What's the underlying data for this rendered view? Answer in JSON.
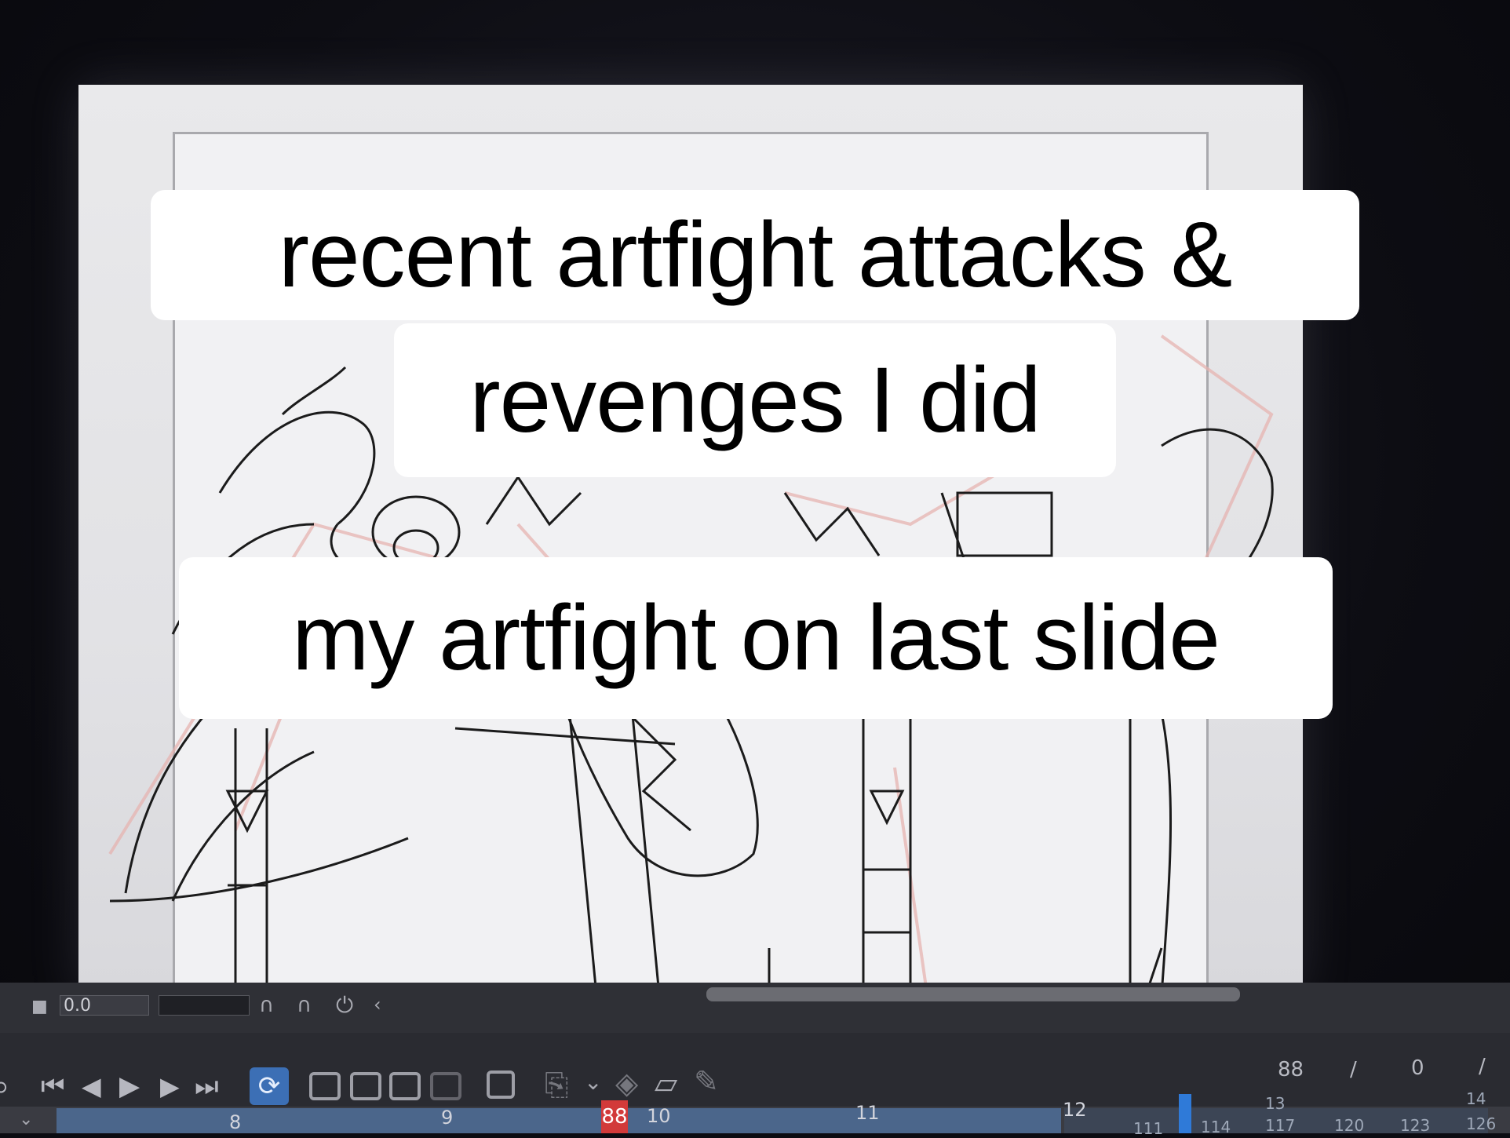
{
  "captions": {
    "line1": "recent artfight attacks &",
    "line2": "revenges I did",
    "line3": "my artfight on last slide"
  },
  "timeline": {
    "frame_value": "0.0",
    "current_frame": "88",
    "counter": {
      "current": "88",
      "separator1": "/",
      "offset": "0",
      "separator2": "/"
    },
    "major_ticks": [
      "8",
      "9",
      "10",
      "11",
      "12",
      "13",
      "14"
    ],
    "minor_ticks": [
      "111",
      "114",
      "117",
      "120",
      "123",
      "126"
    ],
    "buttons": {
      "first_frame": "⏮",
      "prev_frame": "◀",
      "play": "▶",
      "next_frame": "▶",
      "last_frame": "⏭",
      "loop": "⟳"
    }
  },
  "colors": {
    "background": "#0c0c12",
    "canvas": "#e6e6e9",
    "caption_bg": "#ffffff",
    "caption_text": "#000000",
    "timeline_bg": "#2a2b31",
    "playhead": "#d23a3a",
    "loop_accent": "#3c6fb5"
  }
}
